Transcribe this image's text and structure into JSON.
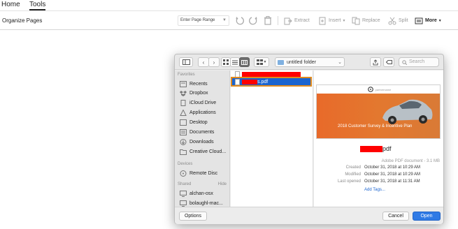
{
  "nav": {
    "home": "Home",
    "tools": "Tools"
  },
  "toolbar": {
    "title": "Organize Pages",
    "page_range": "Enter Page Range",
    "extract": "Extract",
    "insert": "Insert",
    "replace": "Replace",
    "split": "Split",
    "more": "More"
  },
  "dialog": {
    "folder": "untitled folder",
    "search_placeholder": "Search",
    "sidebar": {
      "favorites_header": "Favorites",
      "favorites": [
        "Recents",
        "Dropbox",
        "iCloud Drive",
        "Applications",
        "Desktop",
        "Documents",
        "Downloads",
        "Creative Cloud..."
      ],
      "devices_header": "Devices",
      "devices": [
        "Remote Disc"
      ],
      "shared_header": "Shared",
      "shared_hide": "Hide",
      "shared": [
        "alchan-osx",
        "bolaughl-mac..."
      ]
    },
    "files": {
      "selected_suffix": "s.pdf"
    },
    "preview": {
      "thumb_title": "2018 Customer Survey & Incentive Plan",
      "thumb_brand": "partnername",
      "name_suffix": "pdf",
      "kind": "Adobe PDF document - 3.1 MB",
      "created_label": "Created",
      "created": "October 31, 2018 at 10:29 AM",
      "modified_label": "Modified",
      "modified": "October 31, 2018 at 10:29 AM",
      "last_opened_label": "Last opened",
      "last_opened": "October 31, 2018 at 11:31 AM",
      "add_tags": "Add Tags..."
    },
    "buttons": {
      "options": "Options",
      "cancel": "Cancel",
      "open": "Open"
    }
  },
  "colors": {
    "accent": "#2f7ae5",
    "selection": "#1a64d0",
    "highlight_outline": "#e08a1e",
    "redaction": "#ff0000"
  }
}
